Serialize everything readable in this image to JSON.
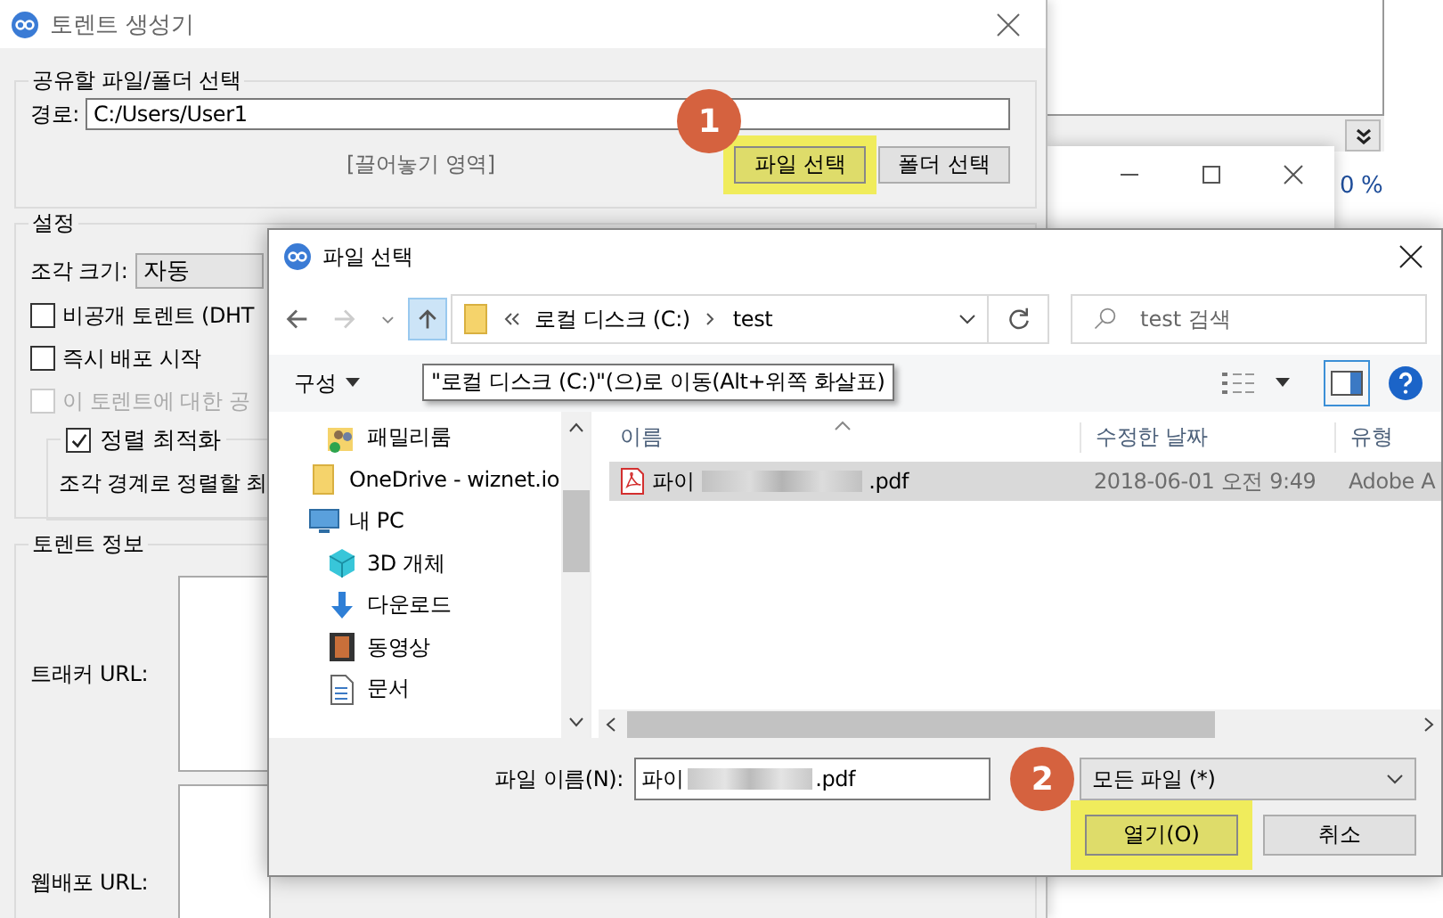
{
  "background_app": {
    "reading": "0 %"
  },
  "main_dialog": {
    "title": "토렌트 생성기",
    "source_group": {
      "title": "공유할 파일/폴더 선택",
      "path_label": "경로:",
      "path_value": "C:/Users/User1",
      "drop_zone": "[끌어놓기 영역]",
      "buttons": [
        {
          "label": "파일 선택",
          "highlighted": true
        },
        {
          "label": "폴더 선택",
          "highlighted": false
        }
      ]
    },
    "settings_group": {
      "title": "설정",
      "piece_size_label": "조각 크기:",
      "piece_size_value": "자동",
      "options": [
        {
          "label": "비공개 토렌트 (DHT",
          "checked": false,
          "disabled": false
        },
        {
          "label": "즉시 배포 시작",
          "checked": false,
          "disabled": false
        },
        {
          "label": "이 토렌트에 대한 공",
          "checked": false,
          "disabled": true
        }
      ],
      "alignment": {
        "label": "정렬 최적화",
        "checked": true,
        "text": "조각 경계로 정렬할 최"
      }
    },
    "info_group": {
      "title": "토렌트 정보",
      "fields": [
        {
          "label": "트래커 URL:"
        },
        {
          "label": "웹배포 URL:"
        }
      ]
    }
  },
  "file_dialog": {
    "title": "파일 선택",
    "breadcrumb": [
      "로컬 디스크 (C:)",
      "test"
    ],
    "search_placeholder": "test 검색",
    "toolbar_menu": "구성",
    "tooltip": "\"로컬 디스크 (C:)\"(으)로 이동(Alt+위쪽 화살표)",
    "nav_tree": [
      {
        "children": [
          {
            "label": "패밀리룸",
            "kind": "family"
          }
        ]
      },
      {
        "label": "OneDrive - wiznet.io",
        "kind": "folder"
      },
      {
        "label": "내 PC",
        "kind": "pc",
        "children": [
          {
            "label": "3D 개체",
            "kind": "cube"
          },
          {
            "label": "다운로드",
            "kind": "download"
          },
          {
            "label": "동영상",
            "kind": "video"
          },
          {
            "label": "문서",
            "kind": "document"
          }
        ]
      }
    ],
    "columns": [
      "이름",
      "수정한 날짜",
      "유형"
    ],
    "files": [
      {
        "name_start": "파이",
        "name_end": ".pdf",
        "modified": "2018-06-01 오전 9:49",
        "type": "Adobe A",
        "selected": true
      }
    ],
    "filename_label": "파일 이름(N):",
    "filename_start": "파이",
    "filename_end": ".pdf",
    "filter": "모든 파일 (*)",
    "buttons": [
      {
        "label": "열기(O)",
        "highlighted": true
      },
      {
        "label": "취소",
        "highlighted": false
      }
    ]
  },
  "annotations": [
    {
      "label": "1"
    },
    {
      "label": "2"
    }
  ]
}
